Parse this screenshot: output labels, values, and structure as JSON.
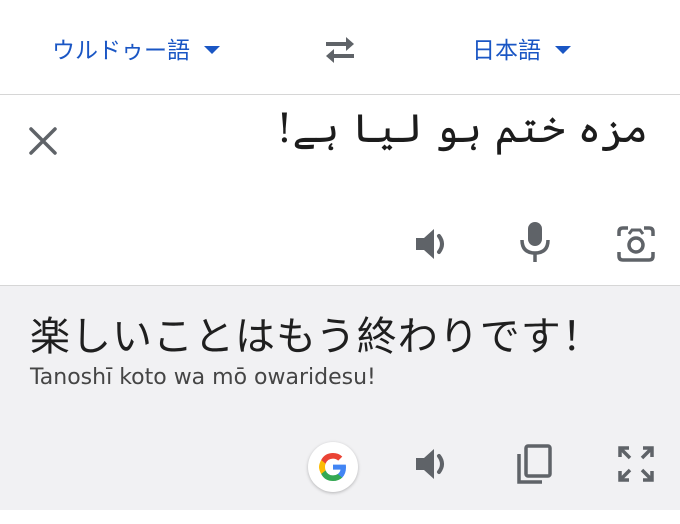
{
  "languages": {
    "source": "ウルドゥー語",
    "target": "日本語"
  },
  "source": {
    "text": "مزہ ختم ہو لیا ہے!"
  },
  "translation": {
    "text": "楽しいことはもう終わりです！",
    "romanization": "Tanoshī koto wa mō owaridesu!"
  },
  "icons": {
    "swap": "swap-arrows-icon",
    "clear": "close-icon",
    "source_listen": "speaker-icon",
    "mic": "microphone-icon",
    "camera": "camera-icon",
    "google": "google-logo-icon",
    "target_listen": "speaker-icon",
    "copy": "copy-icon",
    "fullscreen": "fullscreen-icon"
  },
  "colors": {
    "accent": "#1a56c4",
    "icon": "#5f6368",
    "translation_bg": "#f1f1f3"
  }
}
